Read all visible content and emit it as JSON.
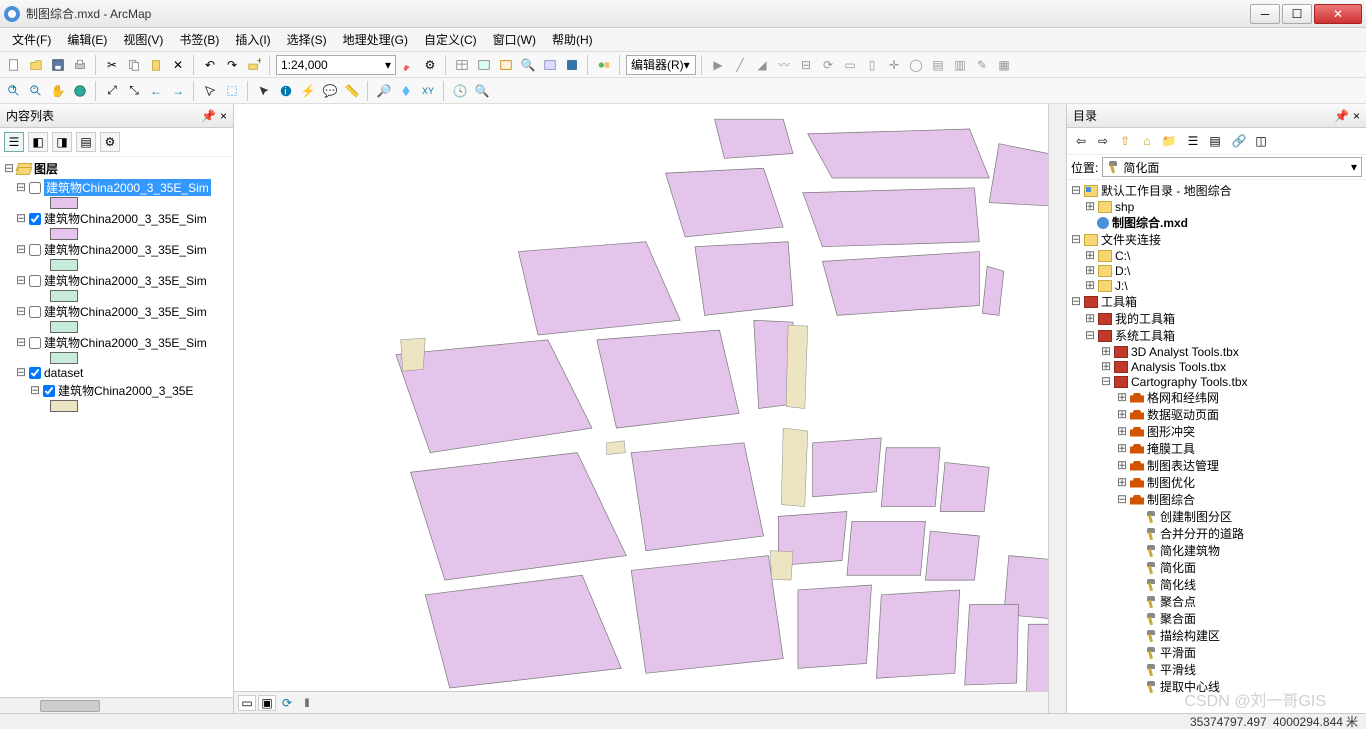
{
  "window": {
    "title": "制图综合.mxd - ArcMap"
  },
  "menus": [
    "文件(F)",
    "编辑(E)",
    "视图(V)",
    "书签(B)",
    "插入(I)",
    "选择(S)",
    "地理处理(G)",
    "自定义(C)",
    "窗口(W)",
    "帮助(H)"
  ],
  "scale": "1:24,000",
  "editor_label": "编辑器(R)",
  "toc": {
    "title": "内容列表",
    "root": "图层",
    "items": [
      {
        "label": "建筑物China2000_3_35E_Sim",
        "checked": false,
        "swatch": "#e4c4ea",
        "selected": true
      },
      {
        "label": "建筑物China2000_3_35E_Sim",
        "checked": true,
        "swatch": "#e4c4ea"
      },
      {
        "label": "建筑物China2000_3_35E_Sim",
        "checked": false,
        "swatch": "#c7ecd9"
      },
      {
        "label": "建筑物China2000_3_35E_Sim",
        "checked": false,
        "swatch": "#c7ecd9"
      },
      {
        "label": "建筑物China2000_3_35E_Sim",
        "checked": false,
        "swatch": "#c7ecd9"
      },
      {
        "label": "建筑物China2000_3_35E_Sim",
        "checked": false,
        "swatch": "#c7ecd9"
      }
    ],
    "dataset_label": "dataset",
    "dataset_child": {
      "label": "建筑物China2000_3_35E",
      "swatch": "#ede5c2"
    }
  },
  "catalog": {
    "title": "目录",
    "location_label": "位置:",
    "location_value": "简化面",
    "default_workdir": "默认工作目录 - 地图综合",
    "shp": "shp",
    "mxd": "制图综合.mxd",
    "folder_conn": "文件夹连接",
    "drives": [
      "C:\\",
      "D:\\",
      "J:\\"
    ],
    "toolboxes": "工具箱",
    "my_toolbox": "我的工具箱",
    "sys_toolbox": "系统工具箱",
    "tbx_items": [
      "3D Analyst Tools.tbx",
      "Analysis Tools.tbx",
      "Cartography Tools.tbx"
    ],
    "carto_sets": [
      "格网和经纬网",
      "数据驱动页面",
      "图形冲突",
      "掩膜工具",
      "制图表达管理",
      "制图优化",
      "制图综合"
    ],
    "carto_tools": [
      "创建制图分区",
      "合并分开的道路",
      "简化建筑物",
      "简化面",
      "简化线",
      "聚合点",
      "聚合面",
      "描绘构建区",
      "平滑面",
      "平滑线",
      "提取中心线"
    ]
  },
  "status": {
    "x": "35374797.497",
    "y": "4000294.844",
    "unit": "米"
  },
  "watermark": "CSDN @刘一哥GIS"
}
